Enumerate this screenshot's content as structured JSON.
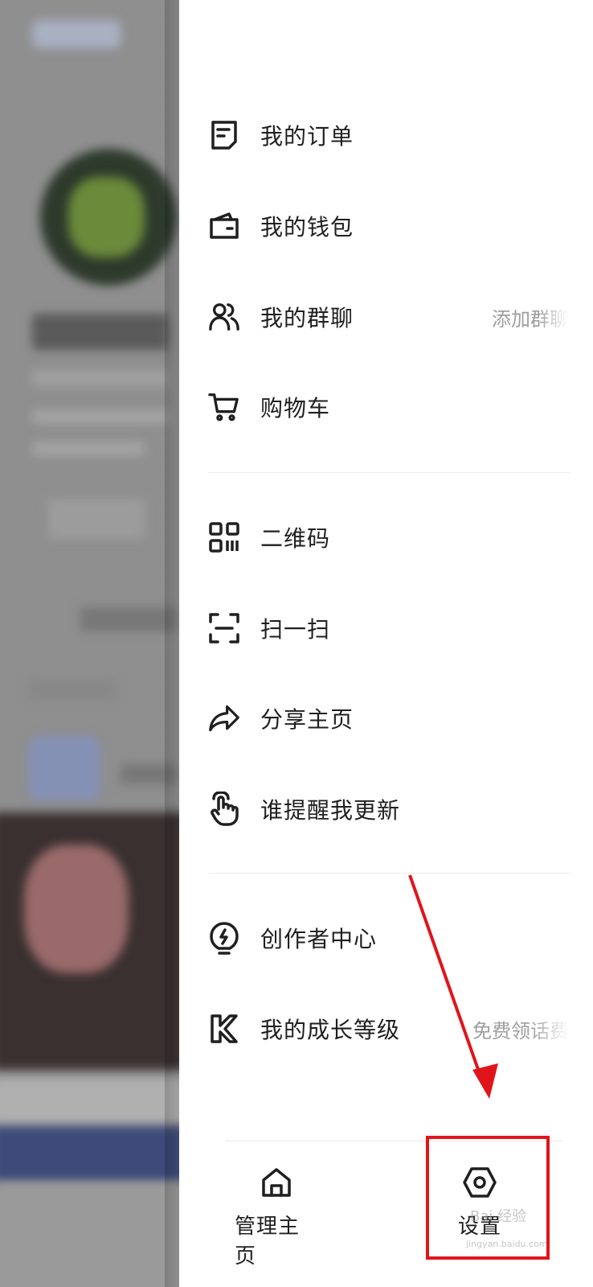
{
  "drawer": {
    "section1": [
      {
        "label": "我的订单",
        "icon": "order-list-icon"
      },
      {
        "label": "我的钱包",
        "icon": "wallet-icon"
      },
      {
        "label": "我的群聊",
        "icon": "group-chat-icon",
        "hint": "添加群聊"
      },
      {
        "label": "购物车",
        "icon": "shopping-cart-icon"
      }
    ],
    "section2": [
      {
        "label": "二维码",
        "icon": "qr-code-icon"
      },
      {
        "label": "扫一扫",
        "icon": "scan-icon"
      },
      {
        "label": "分享主页",
        "icon": "share-arrow-icon"
      },
      {
        "label": "谁提醒我更新",
        "icon": "tap-hand-icon"
      }
    ],
    "section3": [
      {
        "label": "创作者中心",
        "icon": "lightbulb-icon"
      },
      {
        "label": "我的成长等级",
        "icon": "k-badge-icon",
        "hint": "免费领话费"
      }
    ],
    "bottom": {
      "manage_home": "管理主页",
      "settings": "设置"
    }
  },
  "watermark": "Bai 经验",
  "watermark_url": "jingyan.baidu.com",
  "colors": {
    "highlight": "#e0151b",
    "text": "#1f1f1f",
    "hint": "#9e9e9e"
  }
}
